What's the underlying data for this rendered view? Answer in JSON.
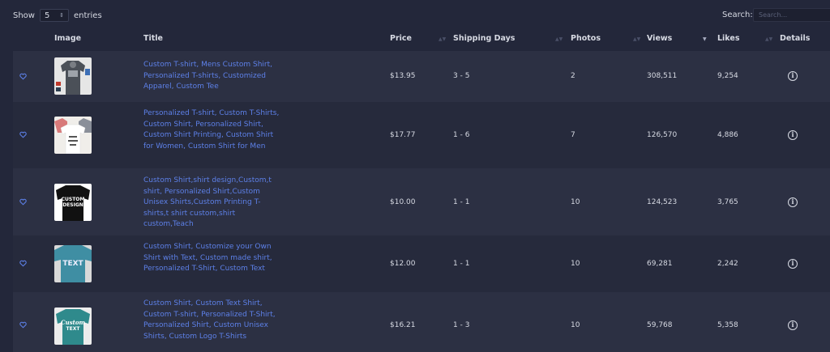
{
  "controls": {
    "show_label": "Show",
    "page_size": "5",
    "entries_label": "entries",
    "search_label": "Search:",
    "search_placeholder": "Search..."
  },
  "columns": {
    "image": "Image",
    "title": "Title",
    "price": "Price",
    "shipping": "Shipping Days",
    "photos": "Photos",
    "views": "Views",
    "likes": "Likes",
    "details": "Details"
  },
  "rows": [
    {
      "title": "Custom T-shirt, Mens Custom Shirt, Personalized T-shirts, Customized Apparel, Custom Tee",
      "price": "$13.95",
      "shipping": "3 - 5",
      "photos": "2",
      "views": "308,511",
      "likes": "9,254"
    },
    {
      "title": "Personalized T-shirt, Custom T-Shirts, Custom Shirt, Personalized Shirt, Custom Shirt Printing, Custom Shirt for Women, Custom Shirt for Men",
      "price": "$17.77",
      "shipping": "1 - 6",
      "photos": "7",
      "views": "126,570",
      "likes": "4,886"
    },
    {
      "title": "Custom Shirt,shirt design,Custom,t shirt, Personalized Shirt,Custom Unisex Shirts,Custom Printing T-shirts,t shirt custom,shirt custom,Teach",
      "price": "$10.00",
      "shipping": "1 - 1",
      "photos": "10",
      "views": "124,523",
      "likes": "3,765",
      "image_text": [
        "CUSTOM",
        "DESIGN"
      ]
    },
    {
      "title": "Custom Shirt, Customize your Own Shirt with Text, Custom made shirt, Personalized T-Shirt, Custom Text",
      "price": "$12.00",
      "shipping": "1 - 1",
      "photos": "10",
      "views": "69,281",
      "likes": "2,242",
      "image_text": [
        "TEXT"
      ]
    },
    {
      "title": "Custom Shirt, Custom Text Shirt, Custom T-shirt, Personalized T-Shirt, Personalized Shirt, Custom Unisex Shirts, Custom Logo T-Shirts",
      "price": "$16.21",
      "shipping": "1 - 3",
      "photos": "10",
      "views": "59,768",
      "likes": "5,358",
      "image_text": [
        "Custom",
        "TEXT"
      ]
    }
  ],
  "colors": {
    "background": "#23273a",
    "row_odd": "#2c3043",
    "row_even": "#262a3c",
    "link": "#5d80e8"
  }
}
